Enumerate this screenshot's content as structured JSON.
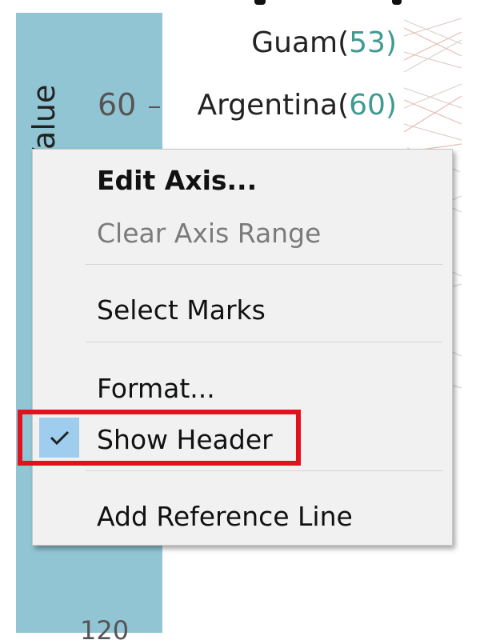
{
  "axis": {
    "header_label": "Value",
    "tick_60": "60",
    "tick_bottom": "120"
  },
  "countries": [
    {
      "name": "Guam(",
      "value": "53",
      "close": ")"
    },
    {
      "name": "Argentina(",
      "value": "60",
      "close": ")"
    }
  ],
  "context_menu": {
    "items": [
      {
        "label": "Edit Axis...",
        "style": "bold",
        "enabled": true
      },
      {
        "label": "Clear Axis Range",
        "style": "normal",
        "enabled": false
      },
      {
        "label": "Select Marks",
        "style": "normal",
        "enabled": true
      },
      {
        "label": "Format...",
        "style": "normal",
        "enabled": true
      },
      {
        "label": "Show Header",
        "style": "normal",
        "enabled": true,
        "checked": true
      },
      {
        "label": "Add Reference Line",
        "style": "normal",
        "enabled": true
      }
    ]
  },
  "colors": {
    "axis_header_bg": "#91c5d4",
    "value_accent": "#3f9a93",
    "menu_bg": "#f1f1f1",
    "check_bg": "#9fcdee",
    "highlight": "#e3101d"
  },
  "icons": {
    "checkmark": "checkmark-icon"
  }
}
